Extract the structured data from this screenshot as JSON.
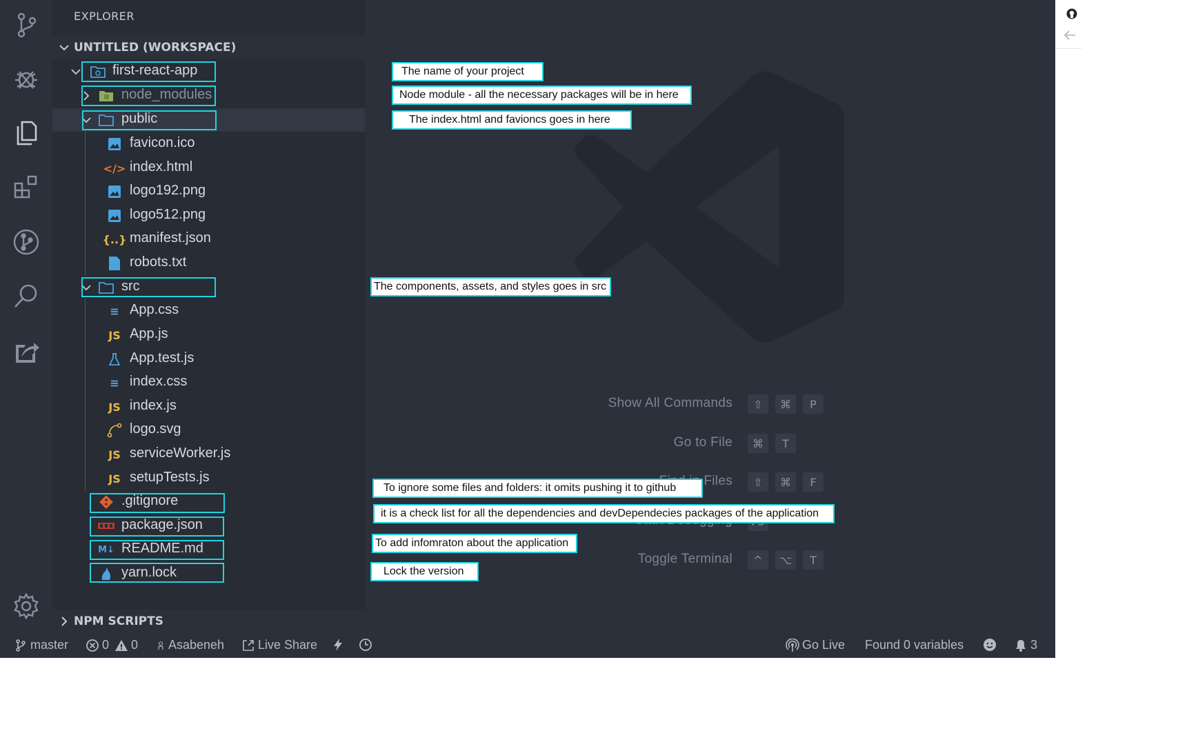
{
  "sidebar": {
    "title": "EXPLORER",
    "workspace": "UNTITLED (WORKSPACE)",
    "npm_scripts": "NPM SCRIPTS",
    "tree": {
      "root": "first-react-app",
      "node_modules": "node_modules",
      "public": "public",
      "public_files": [
        "favicon.ico",
        "index.html",
        "logo192.png",
        "logo512.png",
        "manifest.json",
        "robots.txt"
      ],
      "src": "src",
      "src_files": [
        "App.css",
        "App.js",
        "App.test.js",
        "index.css",
        "index.js",
        "logo.svg",
        "serviceWorker.js",
        "setupTests.js"
      ],
      "root_files": [
        ".gitignore",
        "package.json",
        "README.md",
        "yarn.lock"
      ]
    }
  },
  "editor": {
    "commands": [
      {
        "label": "Show All Commands",
        "keys": [
          "⇧",
          "⌘",
          "P"
        ]
      },
      {
        "label": "Go to File",
        "keys": [
          "⌘",
          "T"
        ]
      },
      {
        "label": "Find in Files",
        "keys": [
          "⇧",
          "⌘",
          "F"
        ]
      },
      {
        "label": "Start Debugging",
        "keys": [
          "F5"
        ]
      },
      {
        "label": "Toggle Terminal",
        "keys": [
          "^",
          "⌥",
          "T"
        ]
      }
    ]
  },
  "annotations": {
    "project": "The name of your project",
    "node_modules": "Node module - all the necessary packages will be in here",
    "public": "The index.html and favioncs goes in here",
    "src": "The components, assets, and styles goes in src",
    "gitignore": "To ignore some files and folders:  it omits pushing it to github",
    "package": "it is a check list for all the dependencies and devDependecies packages of the application",
    "readme": "To add infomraton about the application",
    "yarn": "Lock the version"
  },
  "status": {
    "branch": "master",
    "errors": "0",
    "warnings": "0",
    "user": "Asabeneh",
    "live_share": "Live Share",
    "go_live": "Go Live",
    "variables": "Found 0 variables",
    "notifications": "3"
  },
  "colors": {
    "background": "#2b303b",
    "sidebar": "#272c35",
    "highlight": "#1fd4e0",
    "js_yellow": "#e8b84b",
    "css_blue": "#5fa3d8"
  }
}
